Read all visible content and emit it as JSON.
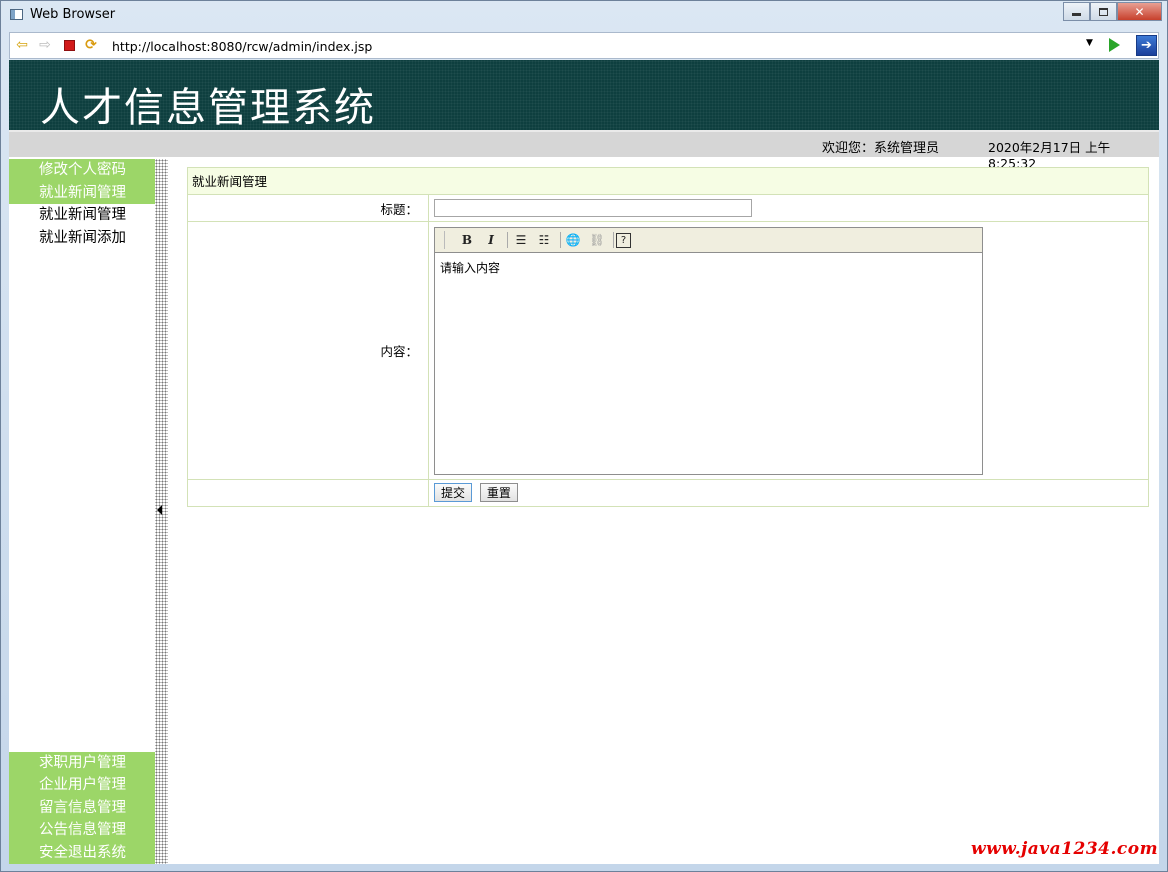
{
  "window": {
    "title": "Web Browser",
    "minimize": "—",
    "maximize": "□",
    "close": "✕"
  },
  "browser": {
    "url": "http://localhost:8080/rcw/admin/index.jsp",
    "icons": {
      "back": "back-arrow-icon",
      "forward": "forward-arrow-icon",
      "stop": "stop-icon",
      "refresh": "refresh-icon",
      "go": "go-icon",
      "exit": "exit-icon"
    }
  },
  "header": {
    "title": "人才信息管理系统",
    "banner_color": "#0e3f3f"
  },
  "infobar": {
    "welcome": "欢迎您：系统管理员",
    "datetime": "2020年2月17日 上午 8:25:32"
  },
  "sidebar": {
    "accent_color": "#9cd668",
    "top_heads": [
      "修改个人密码",
      "就业新闻管理"
    ],
    "sub_items": [
      "就业新闻管理",
      "就业新闻添加"
    ],
    "bottom_heads": [
      "求职用户管理",
      "企业用户管理",
      "留言信息管理",
      "公告信息管理",
      "安全退出系统"
    ]
  },
  "form": {
    "heading": "就业新闻管理",
    "title_label": "标题：",
    "title_value": "",
    "content_label": "内容：",
    "content_placeholder": "请输入内容",
    "toolbar": {
      "bold": "B",
      "italic": "I",
      "help": "?"
    },
    "submit_label": "提交",
    "reset_label": "重置"
  },
  "watermark": "www.java1234.com"
}
